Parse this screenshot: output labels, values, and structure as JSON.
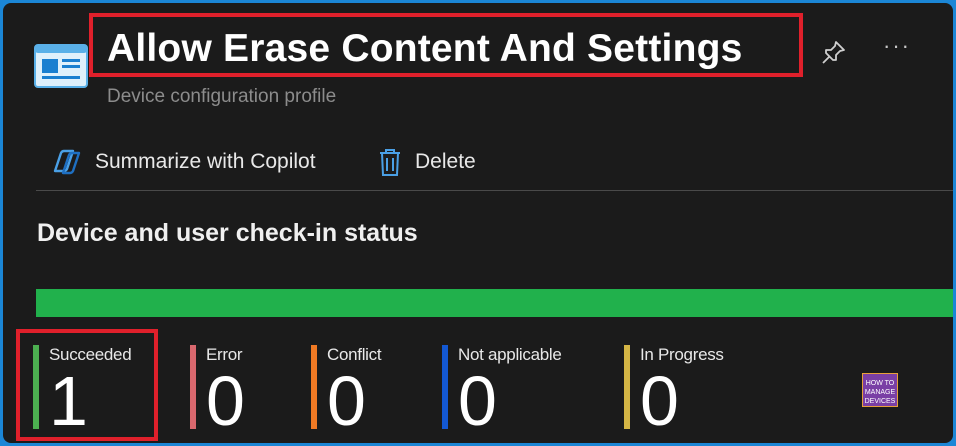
{
  "header": {
    "title": "Allow Erase Content And Settings",
    "subtitle": "Device configuration profile"
  },
  "icons": {
    "profile": "profile-settings-icon",
    "pin": "pin-icon",
    "more": "more-options-icon",
    "copilot": "copilot-icon",
    "delete": "trash-icon"
  },
  "toolbar": {
    "copilot_label": "Summarize with Copilot",
    "delete_label": "Delete",
    "more_label": "···"
  },
  "section": {
    "title": "Device and user check-in status"
  },
  "status_bar": {
    "segments": [
      {
        "status": "Succeeded",
        "fraction": 1.0,
        "color": "#21b14c"
      }
    ]
  },
  "stats": [
    {
      "label": "Succeeded",
      "value": "1",
      "color": "#4caf50"
    },
    {
      "label": "Error",
      "value": "0",
      "color": "#d9686e"
    },
    {
      "label": "Conflict",
      "value": "0",
      "color": "#f07a24"
    },
    {
      "label": "Not applicable",
      "value": "0",
      "color": "#1358d3"
    },
    {
      "label": "In Progress",
      "value": "0",
      "color": "#d4b545"
    }
  ],
  "watermark": {
    "line1": "HOW TO",
    "line2": "MANAGE",
    "line3": "DEVICES"
  },
  "colors": {
    "background": "#1b1b1b",
    "border": "#1b86d6",
    "highlight": "#e0202b",
    "accent": "#4aa0e6"
  }
}
